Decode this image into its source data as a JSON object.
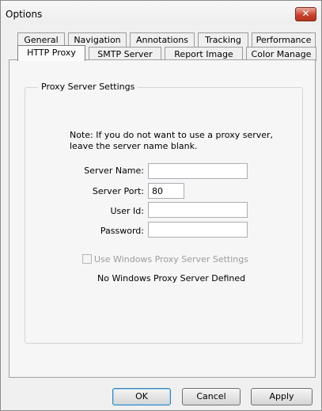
{
  "window": {
    "title": "Options",
    "close_label": "✕"
  },
  "tabs_row1": [
    {
      "label": "General"
    },
    {
      "label": "Navigation"
    },
    {
      "label": "Annotations"
    },
    {
      "label": "Tracking"
    },
    {
      "label": "Performance"
    }
  ],
  "tabs_row2": [
    {
      "label": "HTTP Proxy",
      "selected": true
    },
    {
      "label": "SMTP Server"
    },
    {
      "label": "Report Image"
    },
    {
      "label": "Color Manage"
    }
  ],
  "proxy": {
    "group_title": "Proxy Server Settings",
    "note_line1": "Note:  If you do not want to use a proxy server,",
    "note_line2": "leave the server name blank.",
    "server_name_label": "Server Name:",
    "server_name_value": "",
    "server_port_label": "Server Port:",
    "server_port_value": "80",
    "user_id_label": "User Id:",
    "user_id_value": "",
    "password_label": "Password:",
    "password_value": "",
    "use_windows_label": "Use Windows Proxy Server Settings",
    "use_windows_checked": false,
    "no_windows_proxy": "No Windows Proxy Server Defined"
  },
  "buttons": {
    "ok": "OK",
    "cancel": "Cancel",
    "apply": "Apply"
  },
  "colors": {
    "close_button": "#c7432e",
    "window_bg": "#f0f0f0",
    "default_button_border": "#3c7fb1"
  }
}
